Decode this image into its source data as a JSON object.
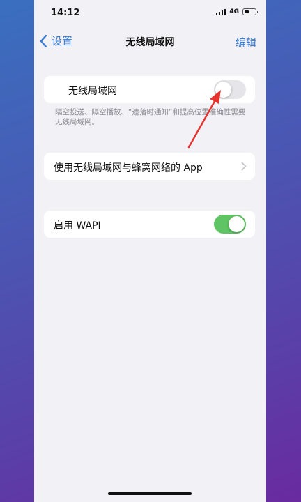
{
  "status_bar": {
    "time": "14:12",
    "network": "4G"
  },
  "nav": {
    "back_label": "设置",
    "title": "无线局域网",
    "edit_label": "编辑"
  },
  "wifi": {
    "label": "无线局域网",
    "enabled": false
  },
  "footnote": "隔空投送、隔空播放、“遗落时通知”和提高位置准确性需要无线局域网。",
  "apps_row": {
    "label": "使用无线局域网与蜂窝网络的 App"
  },
  "wapi": {
    "label": "启用 WAPI",
    "enabled": true
  },
  "colors": {
    "accent": "#3a7bd5",
    "toggle_on": "#5fc463",
    "toggle_off": "#e6e6ea",
    "annotation_arrow": "#e5322d"
  }
}
